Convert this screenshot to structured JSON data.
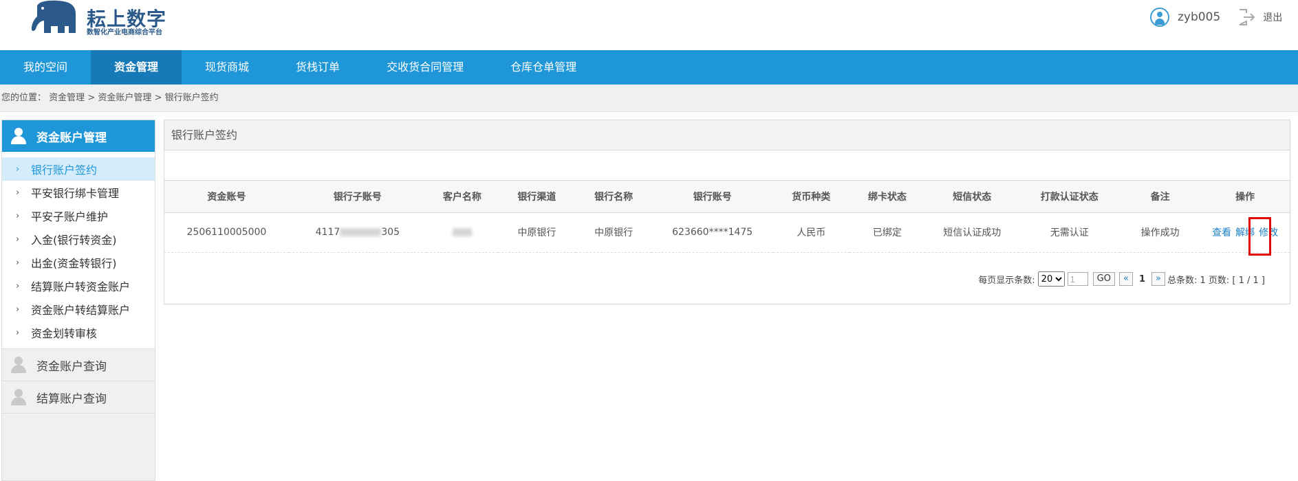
{
  "header": {
    "logo_title": "耘上数字",
    "logo_subtitle": "数智化产业电商综合平台",
    "username": "zyb005",
    "logout_label": "退出"
  },
  "nav": {
    "items": [
      {
        "label": "我的空间"
      },
      {
        "label": "资金管理"
      },
      {
        "label": "现货商城"
      },
      {
        "label": "货栈订单"
      },
      {
        "label": "交收货合同管理"
      },
      {
        "label": "仓库仓单管理"
      }
    ],
    "active_index": 1
  },
  "breadcrumb": {
    "prefix": "您的位置：",
    "items": [
      "资金管理",
      "资金账户管理",
      "银行账户签约"
    ],
    "separator": ">"
  },
  "sidebar": {
    "header": "资金账户管理",
    "items": [
      {
        "label": "银行账户签约"
      },
      {
        "label": "平安银行绑卡管理"
      },
      {
        "label": "平安子账户维护"
      },
      {
        "label": "入金(银行转资金)"
      },
      {
        "label": "出金(资金转银行)"
      },
      {
        "label": "结算账户转资金账户"
      },
      {
        "label": "资金账户转结算账户"
      },
      {
        "label": "资金划转审核"
      }
    ],
    "groups": [
      {
        "label": "资金账户查询"
      },
      {
        "label": "结算账户查询"
      }
    ]
  },
  "panel": {
    "title": "银行账户签约",
    "columns": [
      "资金账号",
      "银行子账号",
      "客户名称",
      "银行渠道",
      "银行名称",
      "银行账号",
      "货币种类",
      "绑卡状态",
      "短信状态",
      "打款认证状态",
      "备注",
      "操作"
    ],
    "rows": [
      {
        "fund_account": "2506110005000",
        "sub_account_prefix": "4117",
        "sub_account_suffix": "305",
        "bank_channel": "中原银行",
        "bank_name": "中原银行",
        "bank_account": "623660****1475",
        "currency": "人民币",
        "bind_status": "已绑定",
        "sms_status": "短信认证成功",
        "payment_auth_status": "无需认证",
        "remark": "操作成功",
        "actions": {
          "view": "查看",
          "unbind": "解绑",
          "edit": "修改"
        }
      }
    ]
  },
  "pagination": {
    "page_size_label": "每页显示条数:",
    "page_size": "20",
    "page_input": "1",
    "go_label": "GO",
    "prev_label": "«",
    "current_page": "1",
    "next_label": "»",
    "total_text": "总条数: 1 页数: [ 1 / 1 ]"
  },
  "colors": {
    "brand_blue": "#1e96d8",
    "nav_active": "#1679b8",
    "highlight_red": "#e00000"
  }
}
